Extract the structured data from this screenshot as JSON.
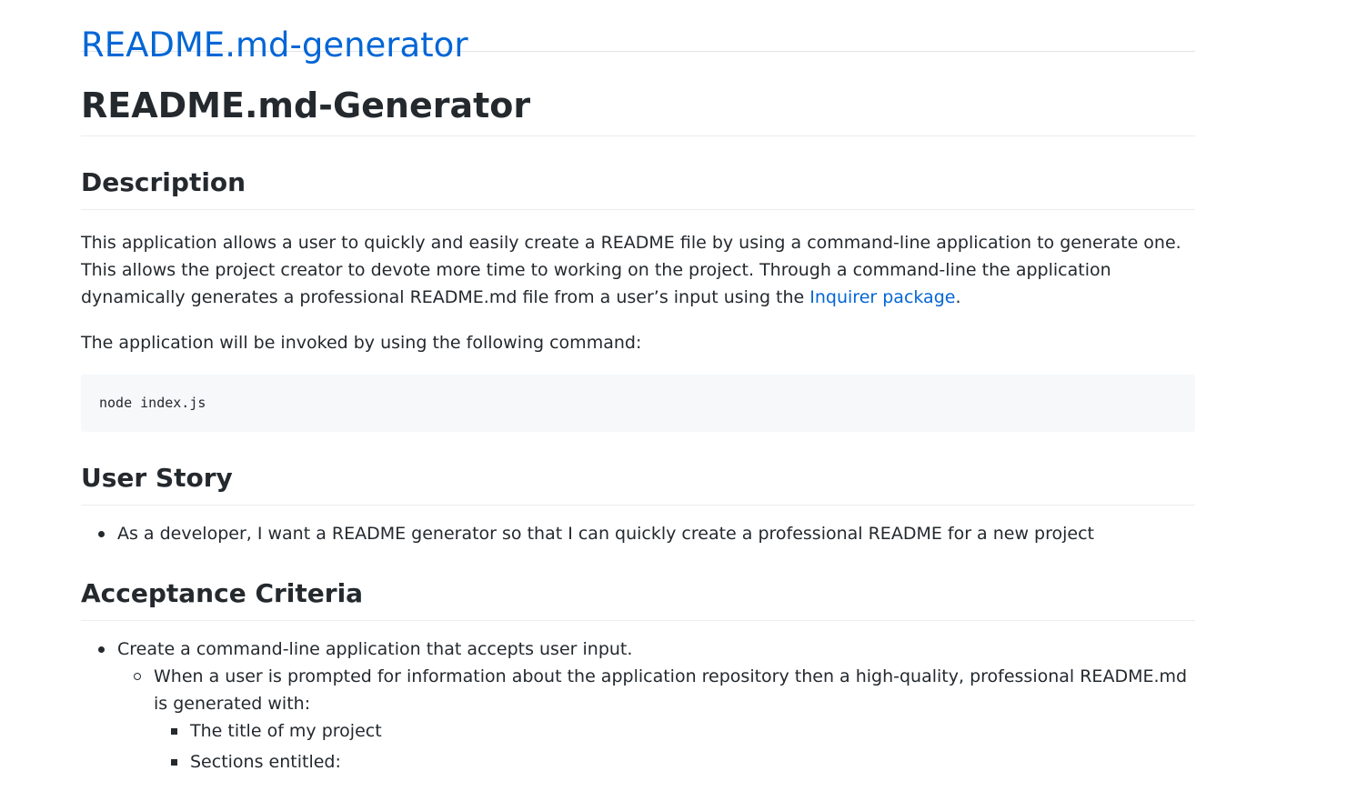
{
  "repo": {
    "title": "README.md-generator"
  },
  "readme": {
    "title": "README.md-Generator",
    "description": {
      "heading": "Description",
      "paragraph_before_link": "This application allows a user to quickly and easily create a README file by using a command-line application to generate one. This allows the project creator to devote more time to working on the project. Through a command-line the application dynamically generates a professional README.md file from a user’s input using the ",
      "link_text": "Inquirer package",
      "paragraph_after_link": ".",
      "invoke_text": "The application will be invoked by using the following command:",
      "code": "node index.js"
    },
    "user_story": {
      "heading": "User Story",
      "items": [
        "As a developer, I want a README generator so that I can quickly create a professional README for a new project"
      ]
    },
    "acceptance_criteria": {
      "heading": "Acceptance Criteria",
      "item1": "Create a command-line application that accepts user input.",
      "subitem1": "When a user is prompted for information about the application repository then a high-quality, professional README.md is generated with:",
      "subsubitems": [
        "The title of my project",
        "Sections entitled:"
      ]
    }
  }
}
